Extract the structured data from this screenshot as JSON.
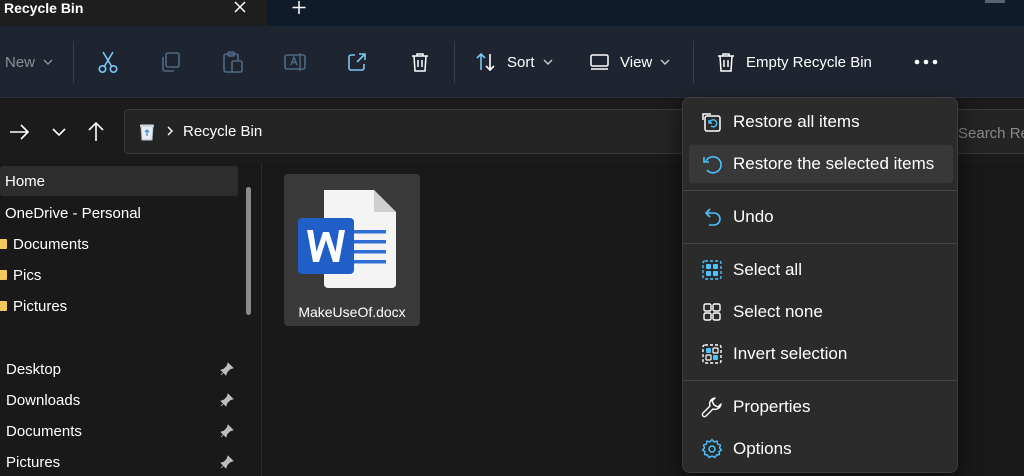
{
  "window": {
    "tab_title": "Recycle Bin",
    "accent": "#4cc2ff"
  },
  "commandbar": {
    "new_label": "New",
    "sort_label": "Sort",
    "view_label": "View",
    "empty_label": "Empty Recycle Bin",
    "icons": [
      "cut-icon",
      "copy-icon",
      "paste-icon",
      "rename-icon",
      "share-icon",
      "delete-icon",
      "more-icon"
    ]
  },
  "address": {
    "location": "Recycle Bin",
    "search_placeholder": "Search Recycle Bin"
  },
  "sidebar": {
    "items": [
      {
        "label": "Home"
      },
      {
        "label": "OneDrive - Personal"
      },
      {
        "label": "Documents"
      },
      {
        "label": "Pics"
      },
      {
        "label": "Pictures"
      },
      {
        "label": "Desktop"
      },
      {
        "label": "Downloads"
      },
      {
        "label": "Documents"
      },
      {
        "label": "Pictures"
      }
    ]
  },
  "files": [
    {
      "name": "MakeUseOf.docx",
      "type": "word-document-icon"
    }
  ],
  "menu": {
    "items": [
      {
        "label": "Restore all items",
        "icon": "restore-all-icon"
      },
      {
        "label": "Restore the selected items",
        "icon": "restore-selected-icon"
      },
      {
        "label": "Undo",
        "icon": "undo-icon"
      },
      {
        "label": "Select all",
        "icon": "select-all-icon"
      },
      {
        "label": "Select none",
        "icon": "select-none-icon"
      },
      {
        "label": "Invert selection",
        "icon": "invert-selection-icon"
      },
      {
        "label": "Properties",
        "icon": "wrench-icon"
      },
      {
        "label": "Options",
        "icon": "gear-icon"
      }
    ]
  }
}
